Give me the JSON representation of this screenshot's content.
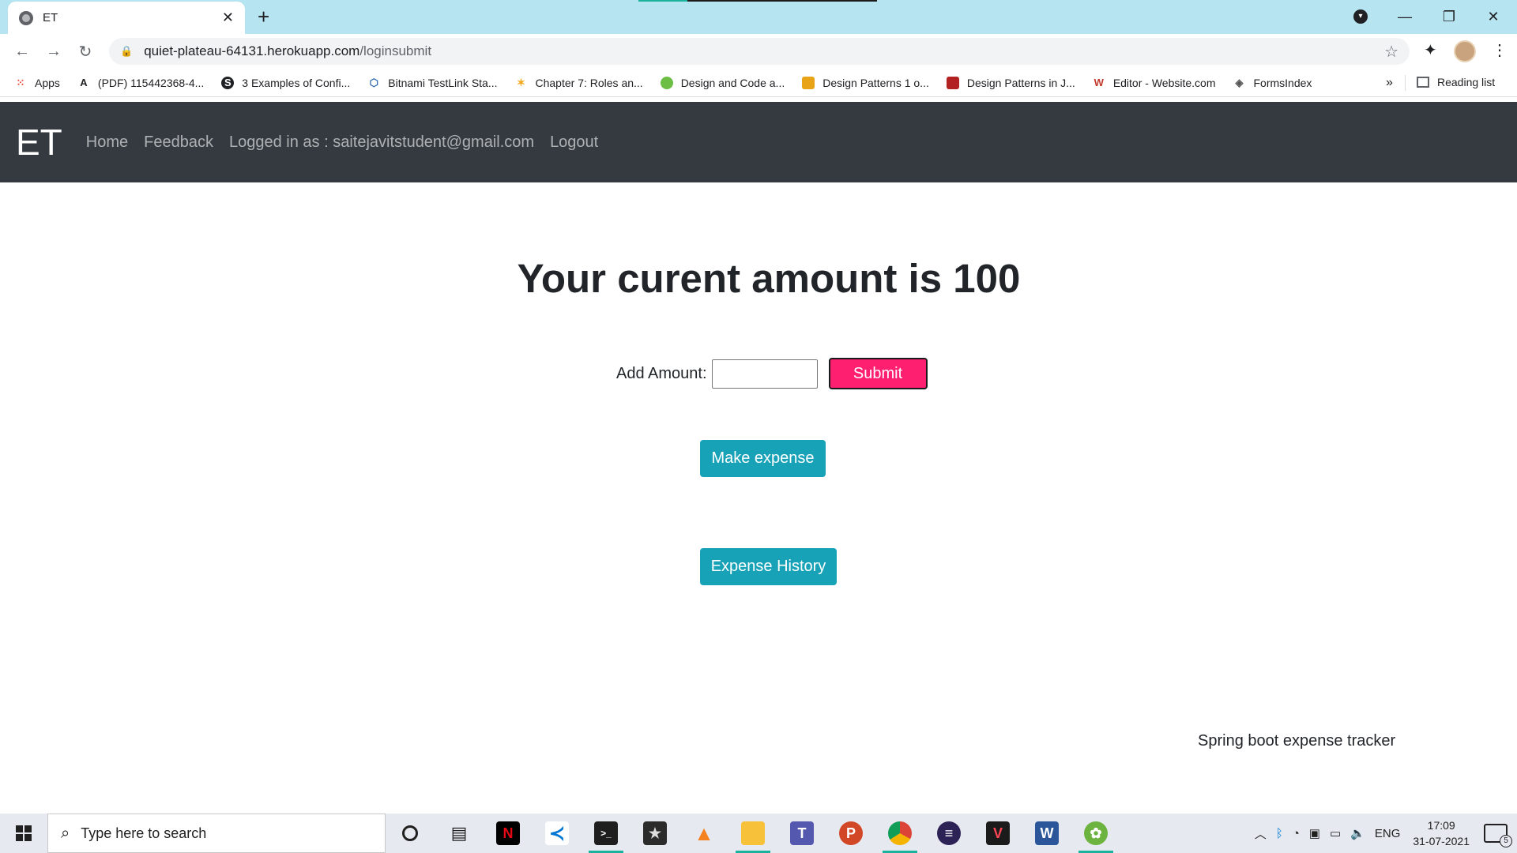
{
  "browser": {
    "tab_title": "ET",
    "url_host": "quiet-plateau-64131.herokuapp.com",
    "url_path": "/loginsubmit",
    "bookmarks": [
      {
        "label": "Apps",
        "icon": "apps-grid-icon",
        "color": "#ea4335"
      },
      {
        "label": "(PDF) 115442368-4...",
        "icon": "academia-a-icon",
        "color": "#202124"
      },
      {
        "label": "3 Examples of Confi...",
        "icon": "s-logo-icon",
        "color": "#202124"
      },
      {
        "label": "Bitnami TestLink Sta...",
        "icon": "bitnami-icon",
        "color": "#2e6ab1"
      },
      {
        "label": "Chapter 7: Roles an...",
        "icon": "sparkle-icon",
        "color": "#f2a81d"
      },
      {
        "label": "Design and Code a...",
        "icon": "leaf-icon",
        "color": "#6cbe45"
      },
      {
        "label": "Design Patterns 1 o...",
        "icon": "owl-icon",
        "color": "#e8a317"
      },
      {
        "label": "Design Patterns in J...",
        "icon": "book-cover-icon",
        "color": "#b22222"
      },
      {
        "label": "Editor - Website.com",
        "icon": "w-logo-icon",
        "color": "#c0392b"
      },
      {
        "label": "FormsIndex",
        "icon": "forms-icon",
        "color": "#555555"
      }
    ],
    "more_bookmarks": "»",
    "reading_list": "Reading list"
  },
  "navbar": {
    "brand": "ET",
    "links": [
      "Home",
      "Feedback",
      "Logged in as : saitejavitstudent@gmail.com",
      "Logout"
    ],
    "bg_color": "#343a40"
  },
  "main": {
    "title": "Your curent amount is 100",
    "add_amount_label": "Add Amount:",
    "add_amount_value": "",
    "submit_label": "Submit",
    "make_expense_label": "Make expense",
    "expense_history_label": "Expense History",
    "footer": "Spring boot expense tracker",
    "colors": {
      "submit": "#ff1f71",
      "teal": "#17a2b8"
    }
  },
  "taskbar": {
    "search_placeholder": "Type here to search",
    "apps": [
      "cortana-circle-icon",
      "task-view-icon",
      "netflix-icon",
      "vscode-icon",
      "terminal-icon",
      "star-app-icon",
      "vlc-icon",
      "file-explorer-icon",
      "teams-icon",
      "powerpoint-icon",
      "chrome-icon",
      "eclipse-icon",
      "valorant-icon",
      "word-icon",
      "spring-tool-suite-icon"
    ],
    "language": "ENG",
    "time": "17:09",
    "date": "31-07-2021",
    "notification_count": "5"
  }
}
